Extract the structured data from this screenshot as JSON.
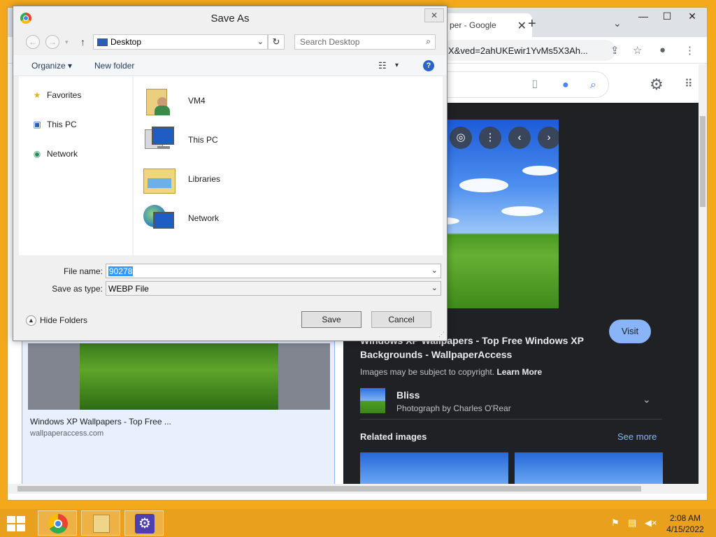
{
  "chrome": {
    "tab_title": "per - Google",
    "tab_close": "✕",
    "new_tab": "+",
    "tab_search": "⌄",
    "omnibox_text": "X&ved=2ahUKEwir1YvMs5X3Ah...",
    "window_controls": {
      "minimize": "—",
      "maximize": "☐",
      "close": "✕"
    }
  },
  "google": {
    "visit_label": "Visit",
    "result_title": "Windows XP Wallpapers - Top Free Windows XP Backgrounds - WallpaperAccess",
    "copyright_text": "Images may be subject to copyright.",
    "learn_more": "Learn More",
    "bliss_title": "Bliss",
    "bliss_sub": "Photograph by Charles O'Rear",
    "related_label": "Related images",
    "see_more": "See more",
    "left_card_title": "Windows XP Wallpapers - Top Free ...",
    "left_card_source": "wallpaperaccess.com"
  },
  "dialog": {
    "title": "Save As",
    "close": "✕",
    "address": "Desktop",
    "search_placeholder": "Search Desktop",
    "organize": "Organize ▾",
    "new_folder": "New folder",
    "help": "?",
    "nav_items": [
      {
        "label": "Favorites",
        "icon": "star-icon"
      },
      {
        "label": "This PC",
        "icon": "computer-icon"
      },
      {
        "label": "Network",
        "icon": "network-icon"
      }
    ],
    "files": [
      {
        "label": "VM4",
        "icon": "user-folder-icon"
      },
      {
        "label": "This PC",
        "icon": "computer-icon"
      },
      {
        "label": "Libraries",
        "icon": "libraries-folder-icon"
      },
      {
        "label": "Network",
        "icon": "network-globe-icon"
      }
    ],
    "file_name_label": "File name:",
    "file_name_value": "90278",
    "save_type_label": "Save as type:",
    "save_type_value": "WEBP File",
    "hide_folders": "Hide Folders",
    "save": "Save",
    "cancel": "Cancel"
  },
  "taskbar": {
    "time": "2:08 AM",
    "date": "4/15/2022"
  }
}
